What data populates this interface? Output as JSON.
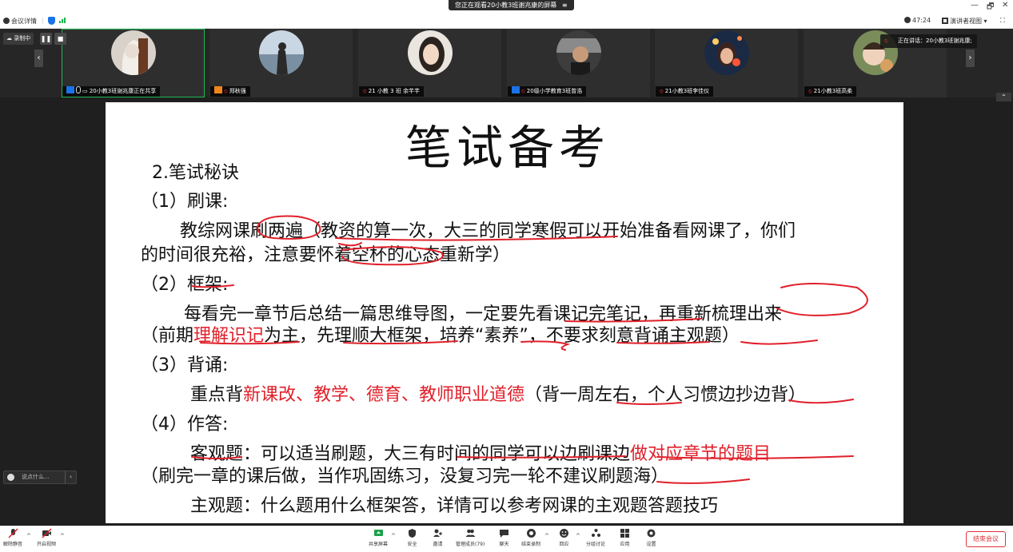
{
  "top_bar": {
    "share_notice": "您正在观看20小教3班谢兆康的屏幕",
    "win_minimize": "—",
    "win_restore": "🗗",
    "win_close": "✕"
  },
  "info_bar": {
    "meeting_details": "会议详情",
    "timer": "47:24",
    "view_mode": "演讲者视图",
    "view_caret": "▾",
    "fullscreen": "⛶"
  },
  "recording": {
    "label": "录制中",
    "pause": "❚❚",
    "stop": "■"
  },
  "participants": [
    {
      "name": "20小教3班谢兆康正在共享",
      "badge": "blue",
      "active": true
    },
    {
      "name": "郑秋强",
      "badge": "orange",
      "active": false
    },
    {
      "name": "21 小教 3 班 余芊芊",
      "badge": "",
      "active": false
    },
    {
      "name": "20级小学教育3班曾浩",
      "badge": "blue",
      "active": false
    },
    {
      "name": "21小教3班李佳仪",
      "badge": "",
      "active": false
    },
    {
      "name": "21小教3班高柔",
      "badge": "",
      "active": false
    }
  ],
  "now_speaking": "正在讲话：20小教3班谢兆康;",
  "strip_nav": {
    "prev": "‹",
    "next": "›",
    "collapse": "⌃"
  },
  "slide": {
    "title": "笔试备考",
    "lines": {
      "heading": "2.笔试秘诀",
      "s1_head": "（1）刷课:",
      "s1_l1": "教综网课刷两遍（教资的算一次，大三的同学寒假可以开始准备看网课了，你们",
      "s1_l2": "的时间很充裕，注意要怀着空杯的心态重新学）",
      "s2_head": "（2）框架:",
      "s2_l1": "每看完一章节后总结一篇思维导图，一定要先看课记完笔记，再重新梳理出来",
      "s2_l2_a": "（前期",
      "s2_l2_red": "理解识记",
      "s2_l2_b": "为主，先理顺大框架，培养“素养”，不要求刻意背诵主观题）",
      "s3_head": "（3）背诵:",
      "s3_l1_a": "重点背",
      "s3_l1_red": "新课改、教学、德育、教师职业道德",
      "s3_l1_b": "（背一周左右，个人习惯边抄边背）",
      "s4_head": "（4）作答:",
      "s4_l1_a": "客观题：可以适当刷题，大三有时间的同学可以边刷课边",
      "s4_l1_red": "做对应章节的题目",
      "s4_l2": "（刷完一章的课后做，当作巩固练习，没复习完一轮不建议刷题海）",
      "s4_l3": "主观题：什么题用什么框架答，详情可以参考网课的主观题答题技巧"
    }
  },
  "chat": {
    "placeholder": "说点什么...",
    "arrow": "‹"
  },
  "toolbar": {
    "unmute": "解除静音",
    "start_video": "开启视频",
    "share_screen": "共享屏幕",
    "security": "安全",
    "invite": "邀请",
    "manage_members": "管理成员(79)",
    "chat": "聊天",
    "end_recording": "结束录制",
    "reactions": "回应",
    "breakout": "分组讨论",
    "apps": "应用",
    "settings": "设置",
    "end_meeting": "结束会议",
    "caret": "^"
  },
  "colors": {
    "accent_red": "#e0202a",
    "active_tile": "#1db954",
    "brand_blue": "#1a73e8"
  }
}
